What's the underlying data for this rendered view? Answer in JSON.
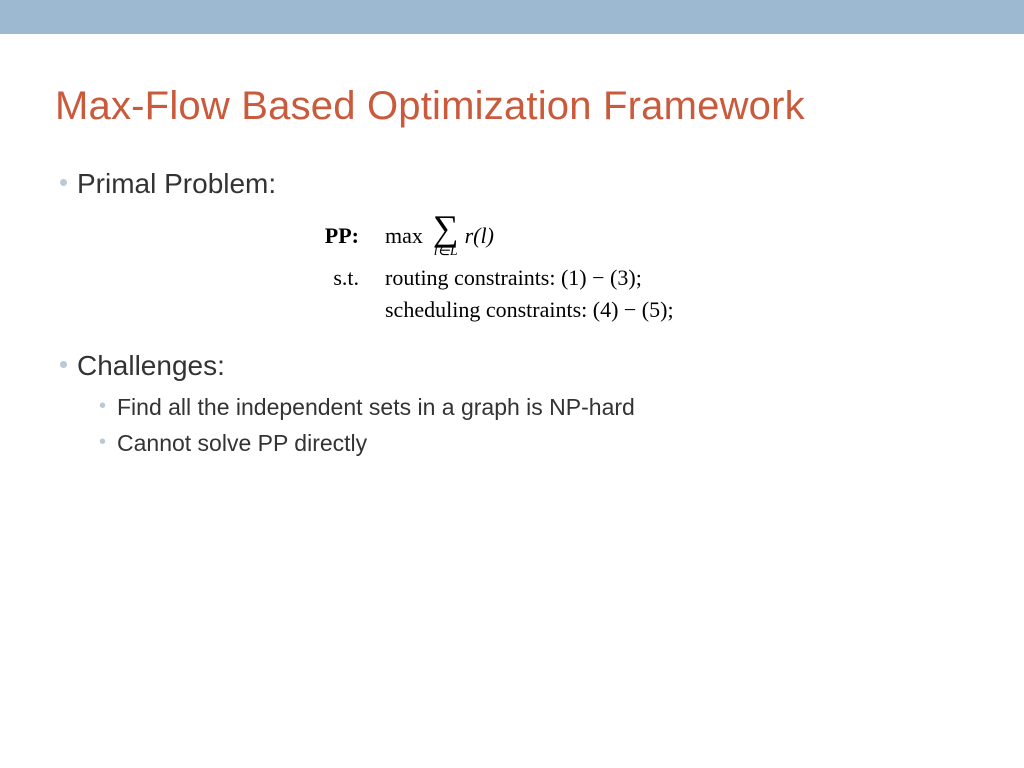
{
  "title": "Max-Flow Based Optimization Framework",
  "bullets": {
    "primal": "Primal Problem:",
    "challenges": "Challenges:",
    "sub": {
      "np_hard": "Find all the independent sets in a graph is NP-hard",
      "cannot_solve": "Cannot solve PP directly"
    }
  },
  "math": {
    "pp_label": "PP:",
    "max": "max",
    "sum_sub": "l∈L",
    "rl": "r(l)",
    "st": "s.t.",
    "routing": "routing constraints: (1) − (3);",
    "scheduling": "scheduling constraints: (4) − (5);"
  }
}
